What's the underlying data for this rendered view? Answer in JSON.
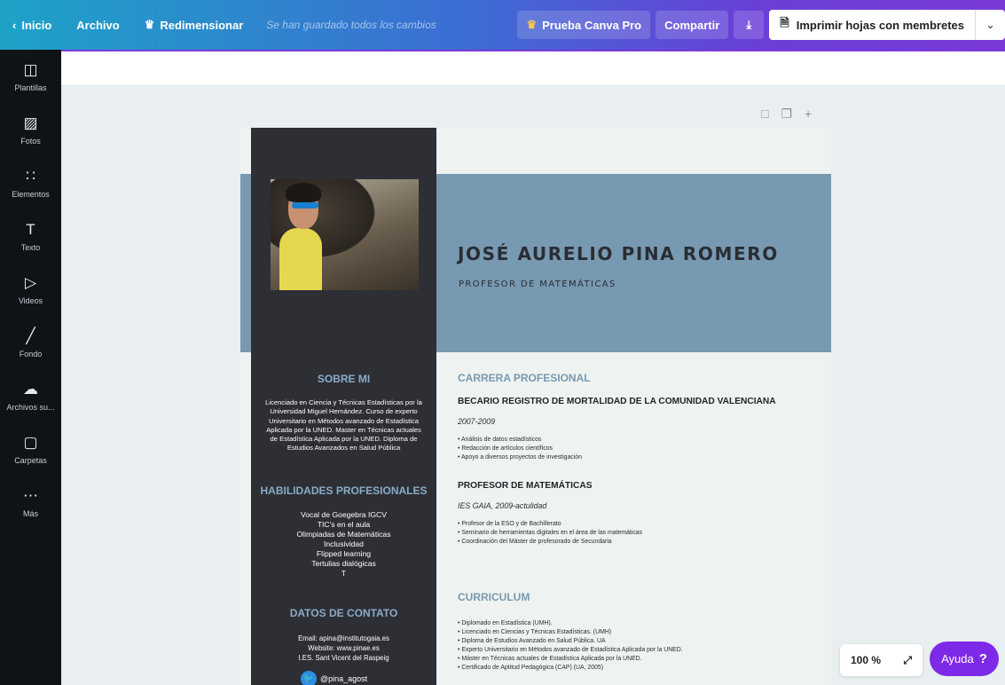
{
  "topbar": {
    "home": "Inicio",
    "file": "Archivo",
    "resize": "Redimensionar",
    "saved_status": "Se han guardado todos los cambios",
    "pro_trial": "Prueba Canva Pro",
    "share": "Compartir",
    "print_action": "Imprimir hojas con membretes"
  },
  "sidebar": {
    "items": [
      {
        "label": "Plantillas",
        "icon": "templates-icon"
      },
      {
        "label": "Fotos",
        "icon": "photos-icon"
      },
      {
        "label": "Elementos",
        "icon": "elements-icon"
      },
      {
        "label": "Texto",
        "icon": "text-icon"
      },
      {
        "label": "Videos",
        "icon": "videos-icon"
      },
      {
        "label": "Fondo",
        "icon": "background-icon"
      },
      {
        "label": "Archivos su...",
        "icon": "upload-icon"
      },
      {
        "label": "Carpetas",
        "icon": "folders-icon"
      },
      {
        "label": "Más",
        "icon": "more-icon"
      }
    ]
  },
  "resume": {
    "name": "JOSÉ AURELIO PINA ROMERO",
    "role": "PROFESOR DE MATEMÁTICAS",
    "about_heading": "SOBRE MI",
    "about_text": "Licenciado en Ciencia y Técnicas Estadísticas por la Universidad Miguel Hernández. Curso de experto Universitario en Métodos avanzado de Estadística Aplicada por la UNED. Master en Técnicas actuales de Estadística Aplicada por la UNED. Diploma de Estudios Avanzados en Salud Pública",
    "skills_heading": "HABILIDADES PROFESIONALES",
    "skills": [
      "Vocal de Goegebra IGCV",
      "TIC's en el aula",
      "Olimpiadas de Matemáticas",
      "Inclusividad",
      "Flipped learning",
      "Tertulias dialógicas",
      "T"
    ],
    "contact_heading": "DATOS DE CONTATO",
    "contact": [
      "Email: apina@institutogaia.es",
      "Website: www.pinae.es",
      "I.ES. Sant Vicent del Raspeig"
    ],
    "twitter": "@pina_agost",
    "career_heading": "CARRERA PROFESIONAL",
    "job1": {
      "title": "BECARIO REGISTRO DE MORTALIDAD DE LA COMUNIDAD VALENCIANA",
      "meta": "2007-2009",
      "bullets": [
        "Análisis de datos estadísticos",
        "Redacción de artículos científicos",
        "Apoyo a diversos proyectos de investigación"
      ]
    },
    "job2": {
      "title": "PROFESOR DE MATEMÁTICAS",
      "meta": "IES GAIA, 2009-actulidad",
      "bullets": [
        "Profesor de la ESO y de Bachillerato",
        "Seminario de herramientas digitales en el área de las matemáticas",
        "Coordinación del Máster de profesorado de Secundaria"
      ]
    },
    "curriculum_heading": "CURRICULUM",
    "curriculum": [
      "Diplomado en Estadística (UMH).",
      "Licenciado en Ciencias y Técnicas Estadísticas. (UMH)",
      "Diploma de Estudios Avanzado en Salud Pública. UA",
      "Experto Universitario en Métodos avanzado de Estadística Aplicada por la UNED.",
      "Máster en Técnicas actuales de Estadística Aplicada por la UNED.",
      "Certificado de Aptitud Pedagógica (CAP) (UA, 2005)"
    ]
  },
  "footer": {
    "zoom": "100 %",
    "help": "Ayuda",
    "help_mark": "?"
  },
  "colors": {
    "accent": "#7d2ae8",
    "band": "#7899b2",
    "sidebar_dark": "#2d2f35"
  }
}
